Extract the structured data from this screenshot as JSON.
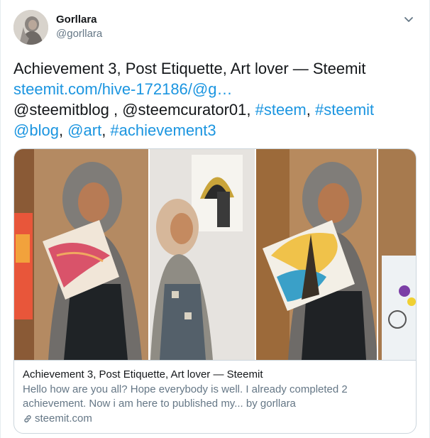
{
  "author": {
    "display_name": "Gorllara",
    "handle": "@gorllara"
  },
  "tweet": {
    "title": "Achievement 3, Post Etiquette, Art lover — Steemit",
    "link_text": "steemit.com/hive-172186/@g…",
    "mention_1": "@steemitblog",
    "separator_1": " , ",
    "mention_2": "@steemcurator01",
    "separator_2": ", ",
    "hashtag_1": "#steem",
    "separator_3": ", ",
    "hashtag_2": "#steemit",
    "mention_3": "@blog",
    "separator_4": ", ",
    "mention_4": "@art",
    "separator_5": ", ",
    "hashtag_3": "#achievement3"
  },
  "card": {
    "title": "Achievement 3, Post Etiquette, Art lover — Steemit",
    "description": "Hello how are you all? Hope everybody is well. I already completed 2 achievement. Now i am here to published my... by gorllara",
    "domain": "steemit.com"
  },
  "icons": {
    "menu": "chevron-down-icon",
    "card_link": "link-icon"
  },
  "colors": {
    "link": "#1b95e0",
    "text": "#14171a",
    "secondary": "#657786",
    "border": "#ccd6dd"
  }
}
